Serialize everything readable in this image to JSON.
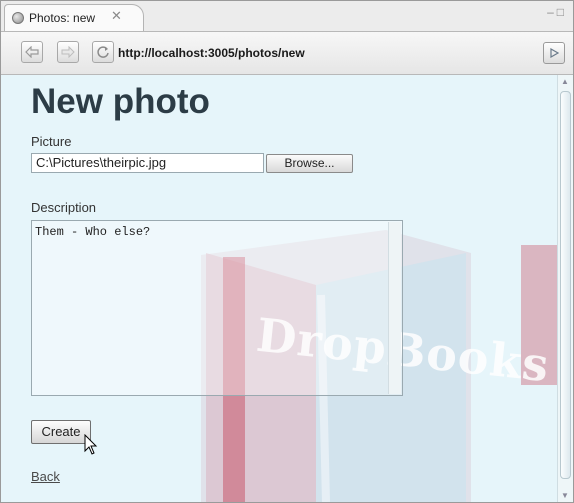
{
  "tab": {
    "title": "Photos: new",
    "close_symbol": "✕"
  },
  "window_controls": {
    "minimize": "‒",
    "maximize": "□"
  },
  "toolbar": {
    "url": "http://localhost:3005/photos/new"
  },
  "page": {
    "heading": "New photo",
    "picture_label": "Picture",
    "picture_value": "C:\\Pictures\\theirpic.jpg",
    "browse_label": "Browse...",
    "description_label": "Description",
    "description_value": "Them - Who else?",
    "create_label": "Create",
    "back_link": "Back"
  },
  "watermark": {
    "text": "DropBooks"
  },
  "colors": {
    "page_background": "#e6f5fa",
    "heading": "#2c3c46",
    "watermark_book": "#c9586b"
  },
  "icons": [
    "globe-icon",
    "close-tab-icon",
    "back-arrow-icon",
    "forward-arrow-icon",
    "refresh-icon",
    "go-icon",
    "mouse-pointer-icon"
  ]
}
